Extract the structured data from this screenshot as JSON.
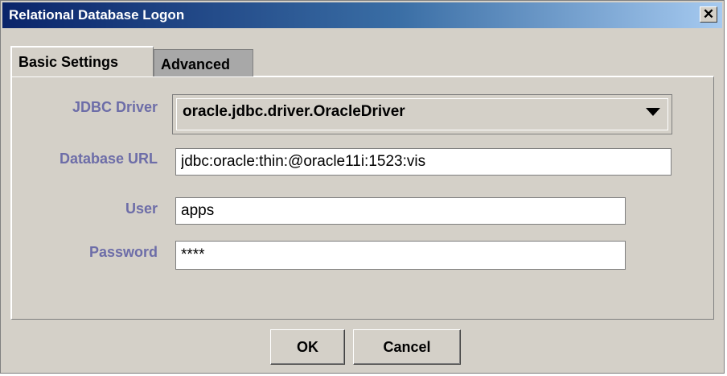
{
  "window": {
    "title": "Relational Database Logon",
    "close_glyph": "✕"
  },
  "tabs": [
    {
      "label": "Basic Settings",
      "active": true
    },
    {
      "label": "Advanced",
      "active": false
    }
  ],
  "form": {
    "jdbc_driver": {
      "label": "JDBC Driver",
      "value": "oracle.jdbc.driver.OracleDriver"
    },
    "database_url": {
      "label": "Database URL",
      "value": "jdbc:oracle:thin:@oracle11i:1523:vis"
    },
    "user": {
      "label": "User",
      "value": "apps"
    },
    "password": {
      "label": "Password",
      "value": "****"
    }
  },
  "buttons": {
    "ok": "OK",
    "cancel": "Cancel"
  },
  "colors": {
    "label": "#6d6da8",
    "titlebar_start": "#0a246a",
    "titlebar_end": "#a6caf0",
    "face": "#d4d0c8"
  }
}
